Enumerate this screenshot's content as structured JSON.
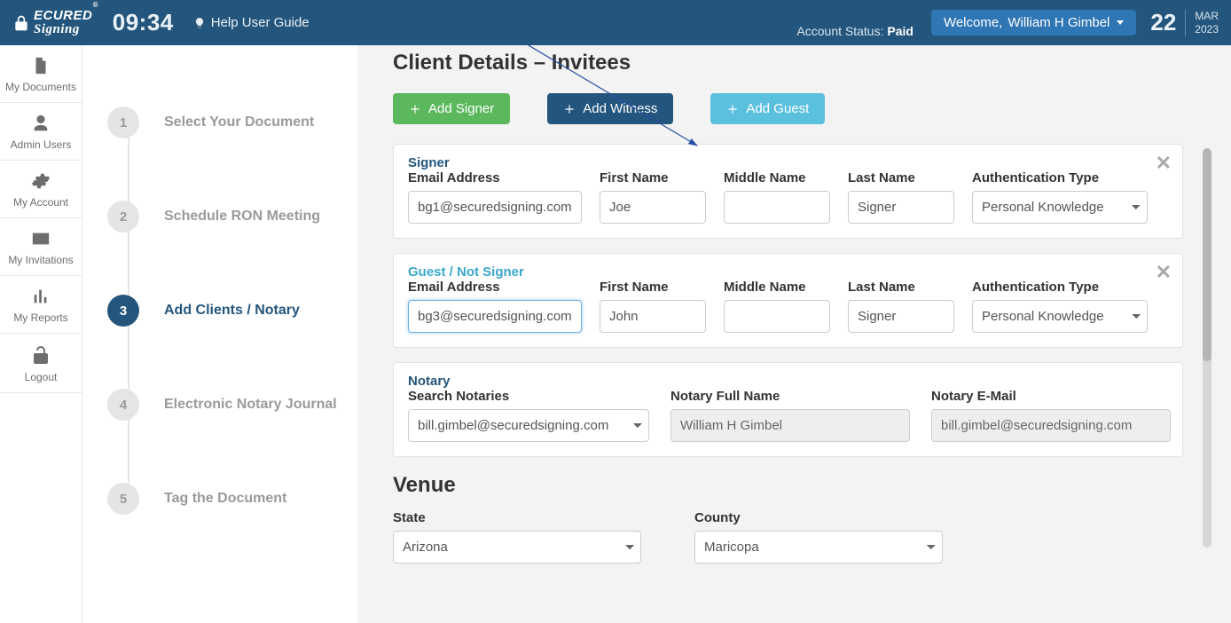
{
  "header": {
    "brand_line1": "ECURED",
    "brand_line2": "Signing",
    "clock": "09:34",
    "help_label": "Help User Guide",
    "account_status_label": "Account Status: ",
    "account_status_value": "Paid",
    "welcome_prefix": "Welcome,  ",
    "welcome_name": "William H Gimbel",
    "date_day": "22",
    "date_month": "MAR",
    "date_year": "2023"
  },
  "sidenav": {
    "documents": "My Documents",
    "admin": "Admin Users",
    "account": "My Account",
    "invitations": "My Invitations",
    "reports": "My Reports",
    "logout": "Logout"
  },
  "stepper": {
    "s1": "Select Your Document",
    "s2": "Schedule RON Meeting",
    "s3": "Add Clients / Notary",
    "s4": "Electronic Notary Journal",
    "s5": "Tag the Document"
  },
  "main": {
    "title": "Client Details – Invitees",
    "btn_signer": "Add Signer",
    "btn_witness": "Add Witness",
    "btn_guest": "Add Guest",
    "signer_heading": "Signer",
    "guest_heading": "Guest / Not Signer",
    "labels": {
      "email": "Email Address",
      "first": "First Name",
      "middle": "Middle Name",
      "last": "Last Name",
      "auth": "Authentication Type"
    },
    "signer": {
      "email": "bg1@securedsigning.com",
      "first": "Joe",
      "middle": "",
      "last": "Signer",
      "auth": "Personal Knowledge"
    },
    "guest": {
      "email": "bg3@securedsigning.com",
      "first": "John",
      "middle": "",
      "last": "Signer",
      "auth": "Personal Knowledge"
    },
    "notary": {
      "heading": "Notary",
      "search_label": "Search Notaries",
      "search_value": "bill.gimbel@securedsigning.com",
      "name_label": "Notary Full Name",
      "name_value": "William H Gimbel",
      "email_label": "Notary E-Mail",
      "email_value": "bill.gimbel@securedsigning.com"
    },
    "venue": {
      "title": "Venue",
      "state_label": "State",
      "state_value": "Arizona",
      "county_label": "County",
      "county_value": "Maricopa"
    }
  }
}
